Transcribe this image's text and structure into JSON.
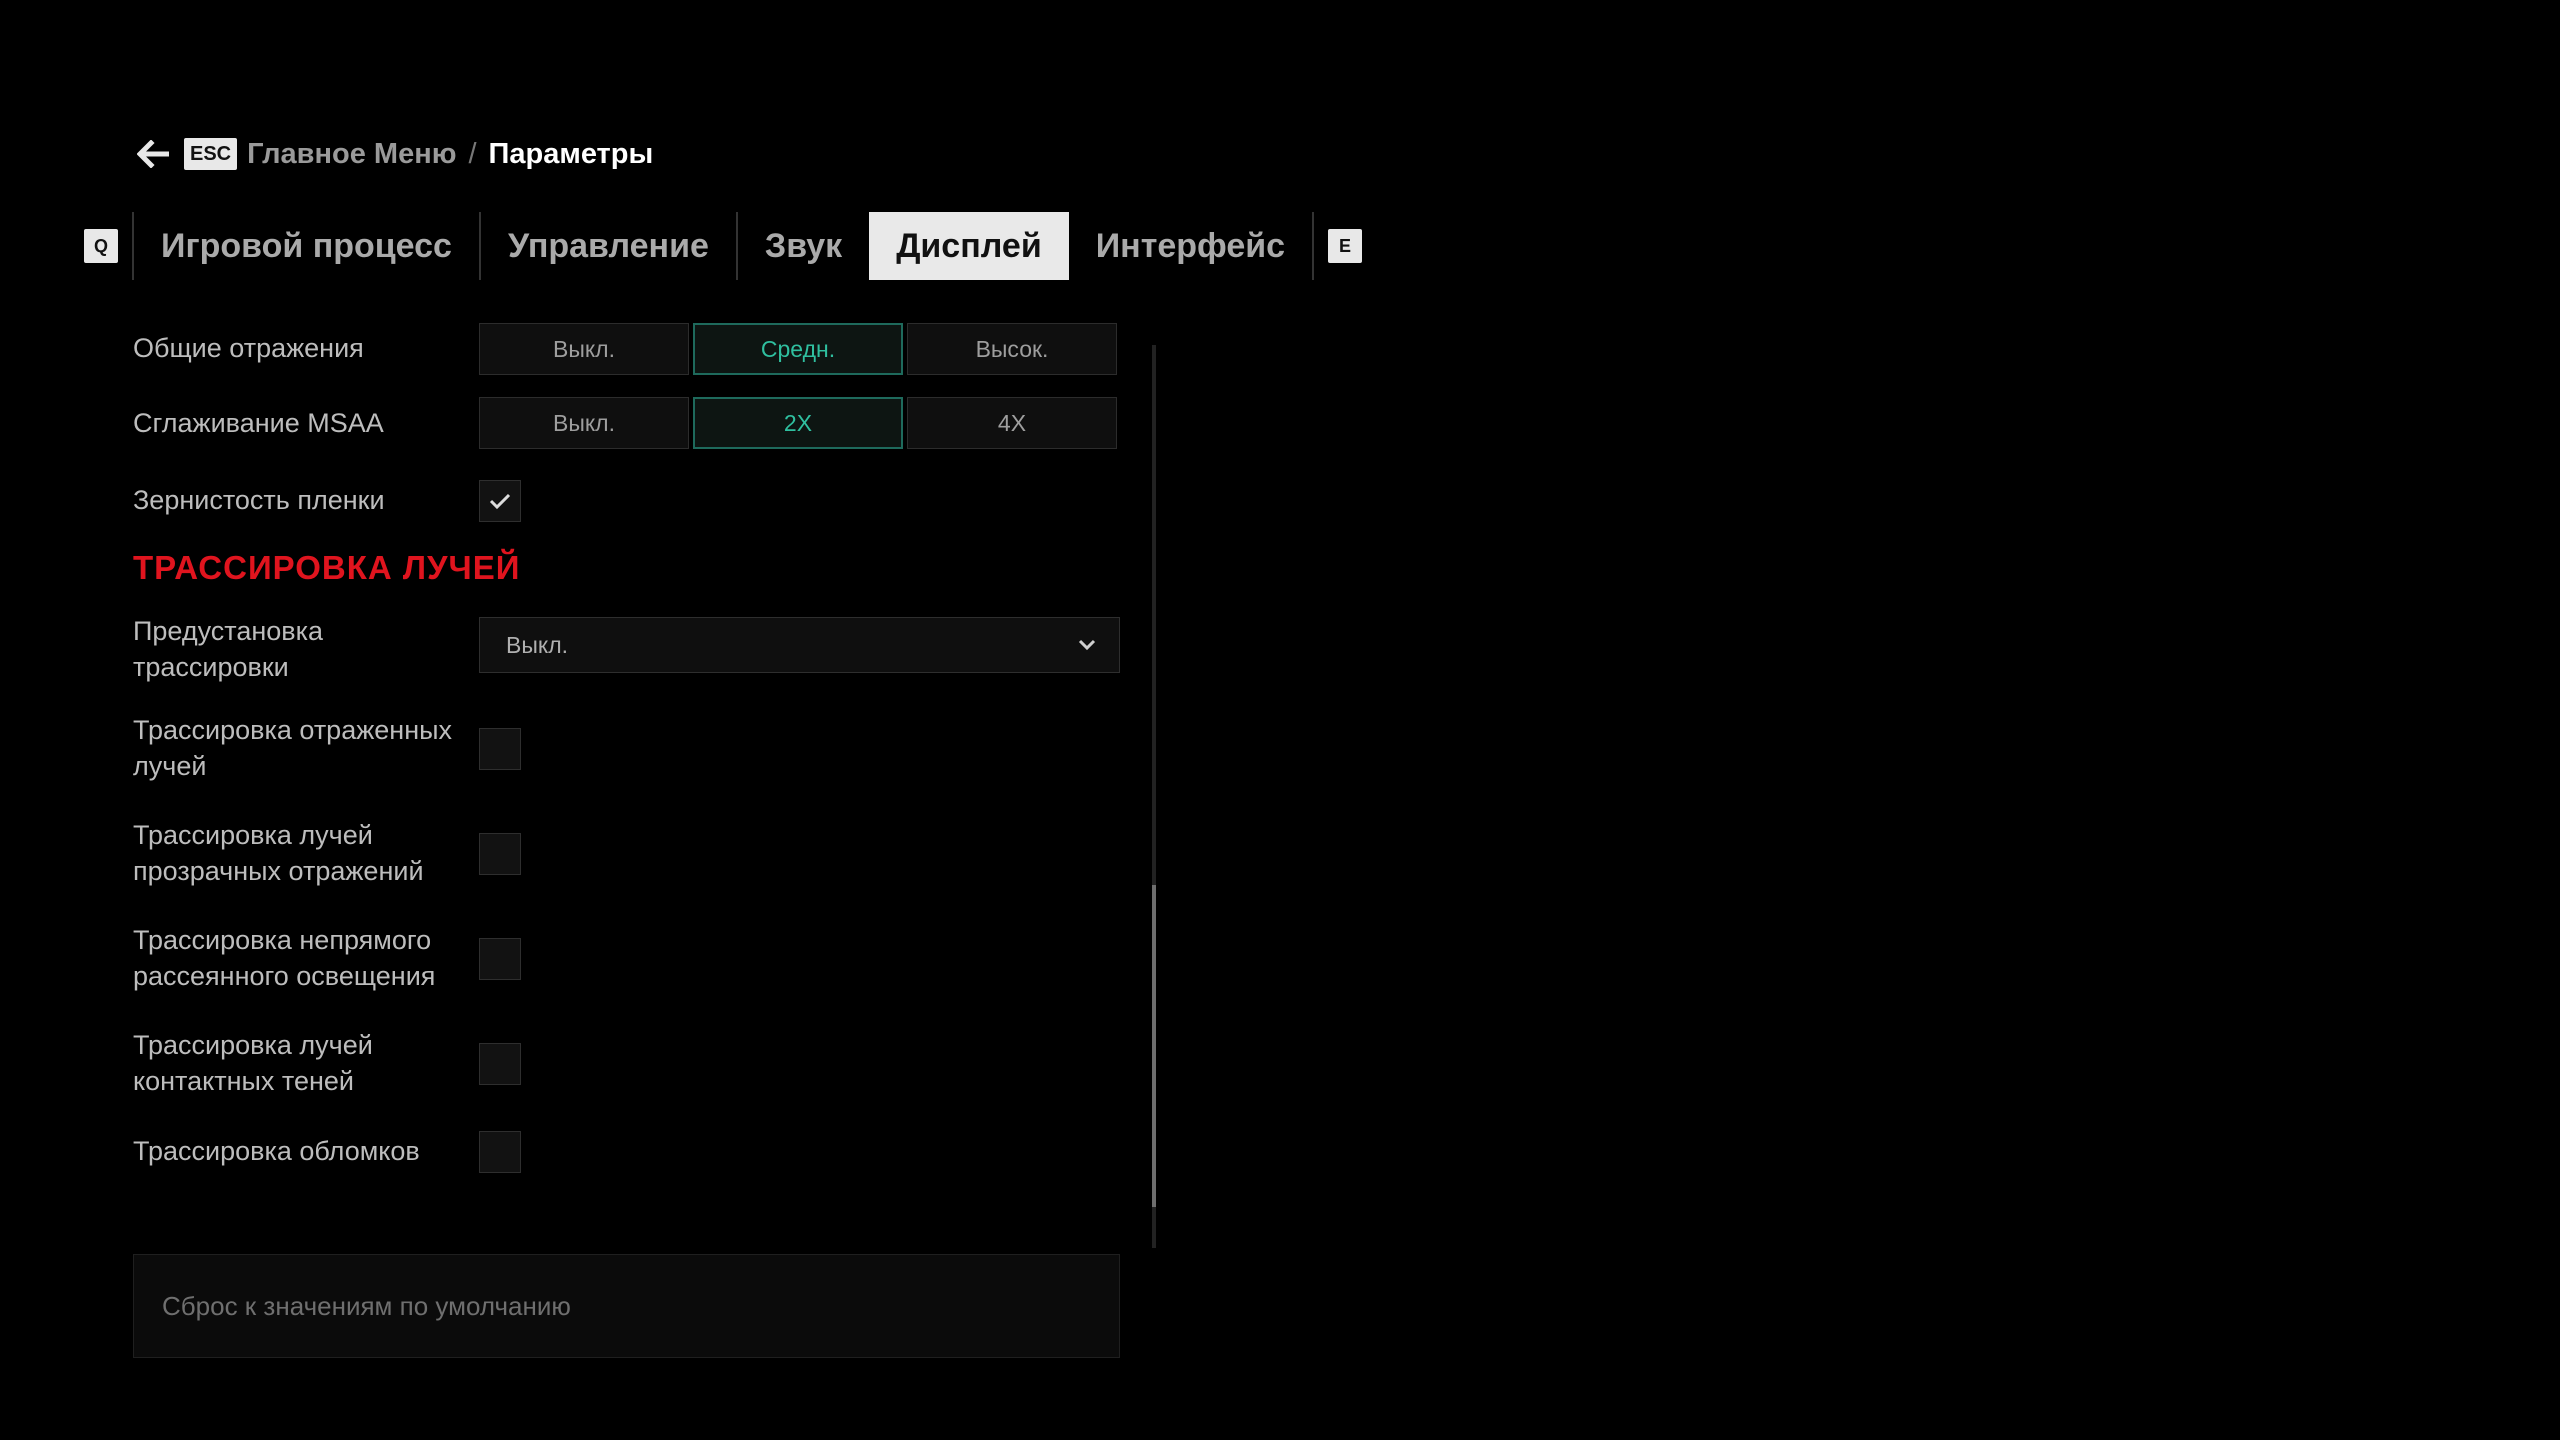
{
  "breadcrumb": {
    "back_key": "ESC",
    "parent": "Главное Меню",
    "separator": "/",
    "current": "Параметры"
  },
  "tabs": {
    "prev_key": "Q",
    "next_key": "E",
    "items": [
      {
        "label": "Игровой процесс"
      },
      {
        "label": "Управление"
      },
      {
        "label": "Звук"
      },
      {
        "label": "Дисплей",
        "active": true
      },
      {
        "label": "Интерфейс"
      }
    ]
  },
  "settings": {
    "reflections": {
      "label": "Общие отражения",
      "options": [
        "Выкл.",
        "Средн.",
        "Высок."
      ],
      "selected": "Средн."
    },
    "msaa": {
      "label": "Сглаживание MSAA",
      "options": [
        "Выкл.",
        "2X",
        "4X"
      ],
      "selected": "2X"
    },
    "film_grain": {
      "label": "Зернистость пленки",
      "checked": true
    },
    "raytracing_title": "ТРАССИРОВКА ЛУЧЕЙ",
    "rt_preset": {
      "label": "Предустановка трассировки",
      "value": "Выкл."
    },
    "rt_reflections": {
      "label": "Трассировка отраженных лучей",
      "checked": false
    },
    "rt_transparent": {
      "label": "Трассировка лучей прозрачных отражений",
      "checked": false
    },
    "rt_gi": {
      "label": "Трассировка непрямого рассеянного освещения",
      "checked": false
    },
    "rt_shadows": {
      "label": "Трассировка лучей контактных теней",
      "checked": false
    },
    "rt_debris": {
      "label": "Трассировка обломков",
      "checked": false
    }
  },
  "reset_label": "Сброс к значениям по умолчанию",
  "colors": {
    "accent": "#2fbf9f",
    "section_title": "#e0141e",
    "active_tab_bg": "#e9e9e9"
  }
}
